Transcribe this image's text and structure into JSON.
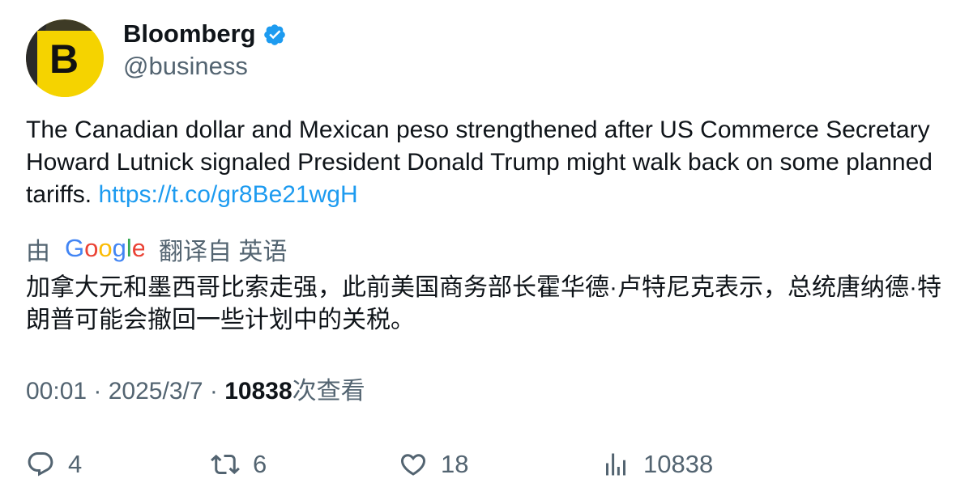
{
  "author": {
    "display_name": "Bloomberg",
    "handle": "@business",
    "avatar_letter": "B",
    "verified": true,
    "brand_color": "#f5d300",
    "verified_color": "#1d9bf0"
  },
  "tweet": {
    "text": "The Canadian dollar and Mexican peso strengthened after US Commerce Secretary Howard Lutnick signaled President Donald Trump might walk back on some planned tariffs. ",
    "link": "https://t.co/gr8Be21wgH"
  },
  "translation": {
    "prefix": "由",
    "provider": "Google",
    "suffix": "翻译自 英语",
    "text": "加拿大元和墨西哥比索走强，此前美国商务部长霍华德·卢特尼克表示，总统唐纳德·特朗普可能会撤回一些计划中的关税。"
  },
  "meta": {
    "time": "00:01",
    "separator": " · ",
    "date": "2025/3/7",
    "views_count": "10838",
    "views_label": "次查看"
  },
  "actions": {
    "reply_count": "4",
    "retweet_count": "6",
    "like_count": "18",
    "views_count": "10838"
  },
  "icons": {
    "reply": "reply-icon",
    "retweet": "retweet-icon",
    "like": "like-icon",
    "views": "views-icon",
    "verified": "verified-badge-icon"
  }
}
